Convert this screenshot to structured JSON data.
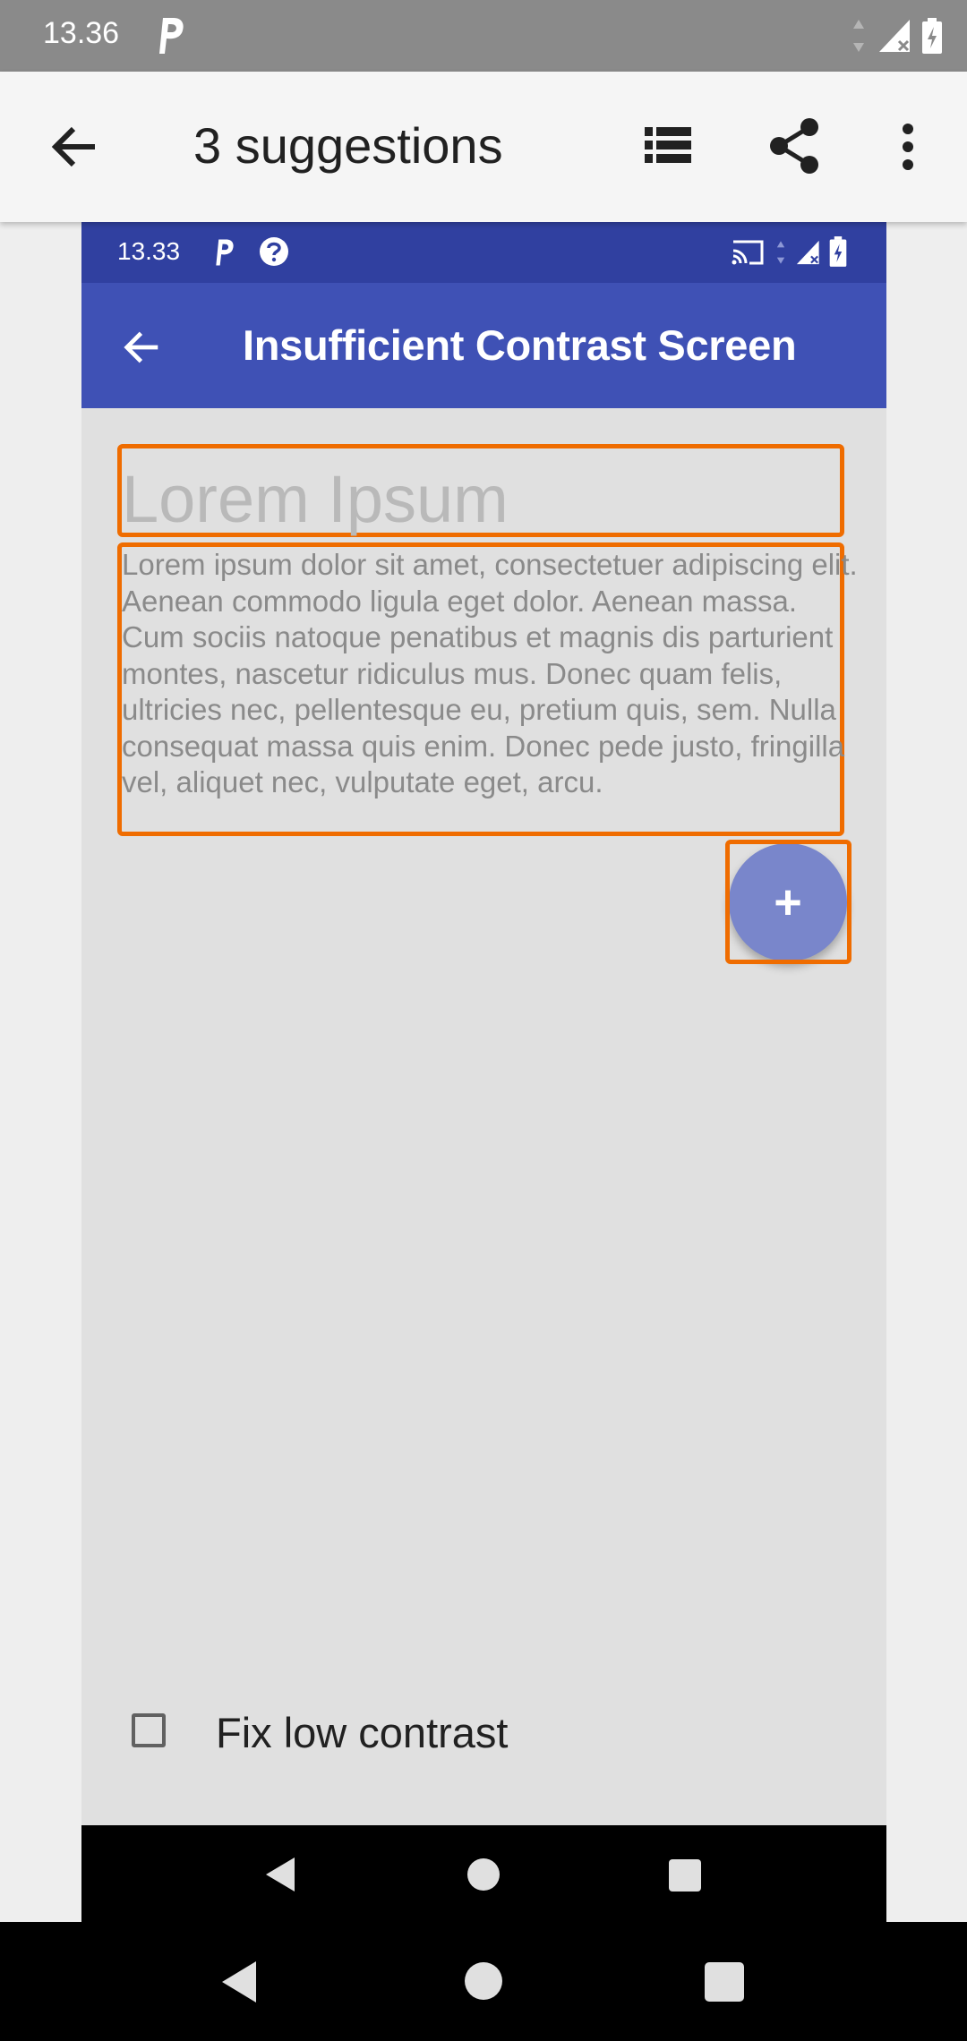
{
  "status_bar": {
    "time": "13.36"
  },
  "app_bar": {
    "title": "3 suggestions"
  },
  "inner_screen": {
    "status_bar": {
      "time": "13.33"
    },
    "toolbar": {
      "title": "Insufficient Contrast Screen"
    },
    "heading": "Lorem Ipsum",
    "body_text": "Lorem ipsum dolor sit amet, consectetuer adipiscing elit. Aenean commodo ligula eget dolor. Aenean massa. Cum sociis natoque penatibus et magnis dis parturient montes, nascetur ridiculus mus. Donec quam felis, ultricies nec, pellentesque eu, pretium quis, sem. Nulla consequat massa quis enim. Donec pede justo, fringilla vel, aliquet nec, vulputate eget, arcu.",
    "fab_label": "+",
    "checkbox": {
      "label": "Fix low contrast",
      "checked": false
    }
  },
  "colors": {
    "highlight": "#ef6c00",
    "toolbar": "#3f51b5",
    "inner_status": "#3040a0",
    "fab": "#7986cb"
  },
  "icons": [
    "back-arrow-icon",
    "list-icon",
    "share-icon",
    "more-vert-icon",
    "p-icon",
    "help-icon",
    "cast-icon",
    "signal-icon",
    "battery-icon",
    "nav-back-icon",
    "nav-home-icon",
    "nav-recents-icon"
  ]
}
